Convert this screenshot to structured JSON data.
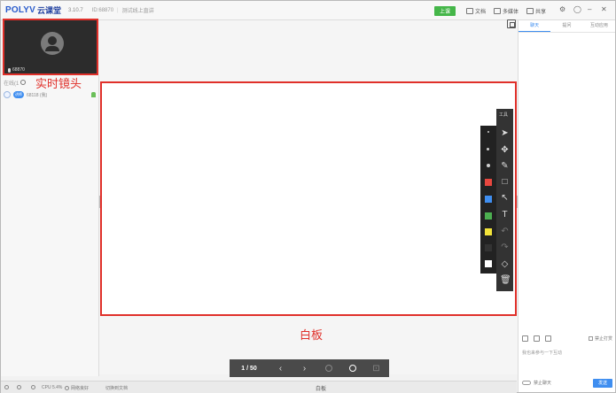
{
  "titlebar": {
    "logo": "POLYV",
    "logo_cn": "云课堂",
    "version": "3.10.7",
    "channel_id": "ID:68870",
    "course_name": "测试线上直讲",
    "start_button": "上课",
    "items": [
      {
        "label": "文档"
      },
      {
        "label": "多媒体"
      },
      {
        "label": "共享"
      }
    ]
  },
  "camera": {
    "user_id": "68870",
    "annotation": "实时镜头"
  },
  "left_panel": {
    "search_placeholder": "在线(1",
    "user": {
      "badge": "讲师",
      "name": "68118 (我)"
    }
  },
  "whiteboard": {
    "annotation": "白板",
    "tool_title": "工具",
    "colors": [
      "#e8473f",
      "#3f8ef0",
      "#4caf50",
      "#f2e33a",
      "#333333",
      "#ffffff"
    ]
  },
  "pager": {
    "page": "1 / 50",
    "prev_icon": "‹",
    "next_icon": "›"
  },
  "statusbar": {
    "cpu": "CPU 5.4%",
    "network": "网络良好",
    "switch_doc": "切换到文档",
    "center_label": "白板"
  },
  "right_panel": {
    "tabs": [
      "聊天",
      "提问",
      "互动应用"
    ],
    "ban_chat": "禁止打赏",
    "input_placeholder": "我也来参与一下互动",
    "mute_label": "禁止聊天",
    "send": "发送"
  }
}
